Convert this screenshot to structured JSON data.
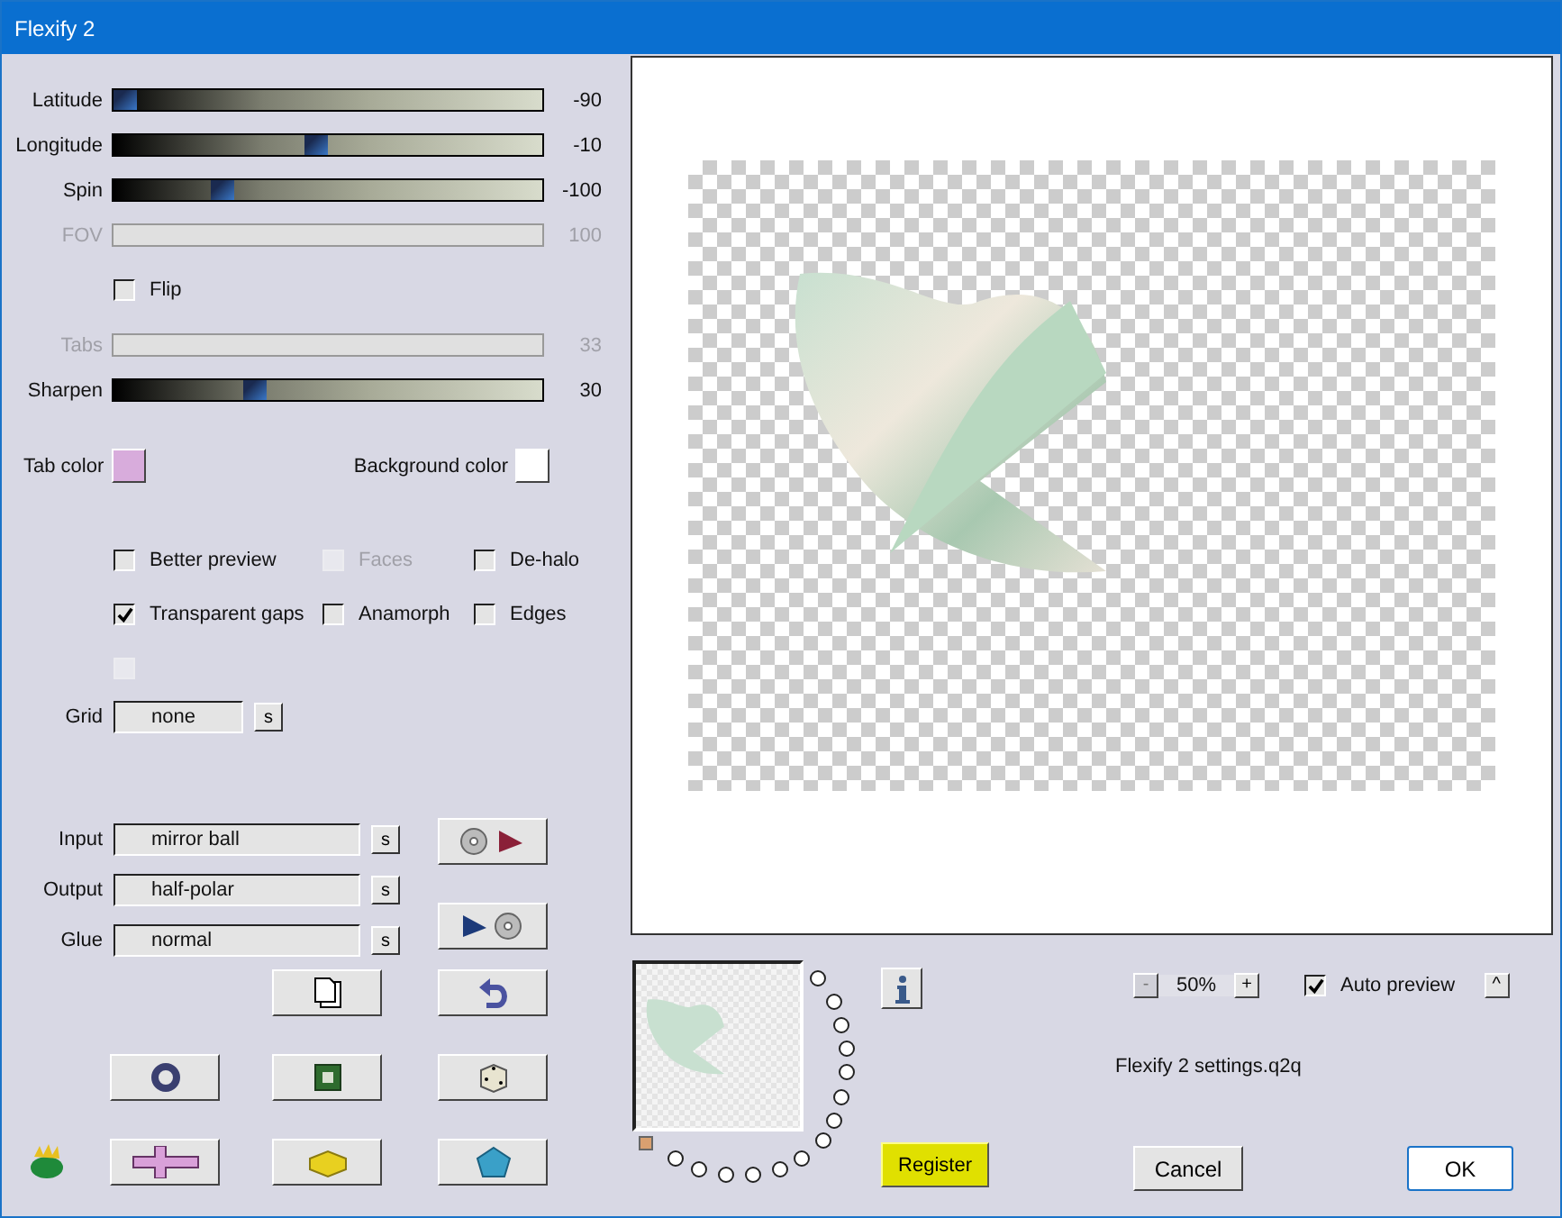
{
  "window": {
    "title": "Flexify 2"
  },
  "sliders": [
    {
      "label": "Latitude",
      "value": "-90",
      "level": 0,
      "disabled": false
    },
    {
      "label": "Longitude",
      "value": "-10",
      "level": 0.47,
      "disabled": false
    },
    {
      "label": "Spin",
      "value": "-100",
      "level": 0.24,
      "disabled": false
    },
    {
      "label": "FOV",
      "value": "100",
      "disabled": true
    },
    {
      "kind": "checkbox",
      "label": "Flip",
      "checked": false
    },
    {
      "label": "Tabs",
      "value": "33",
      "disabled": true
    },
    {
      "label": "Sharpen",
      "value": "30",
      "level": 0.32,
      "disabled": false
    }
  ],
  "colors": [
    {
      "label": "Tab color",
      "color": "#d8acdc"
    },
    {
      "label": "Background color",
      "color": "#ffffff"
    }
  ],
  "options": [
    {
      "label": "Better preview",
      "checked": false,
      "disabled": false
    },
    {
      "label": "Faces",
      "checked": false,
      "disabled": true
    },
    {
      "label": "De-halo",
      "checked": false,
      "disabled": false
    },
    {
      "label": "Transparent gaps",
      "checked": true,
      "disabled": false
    },
    {
      "label": "Anamorph",
      "checked": false,
      "disabled": false
    },
    {
      "label": "Edges",
      "checked": false,
      "disabled": false
    },
    {
      "checked": false,
      "disabled": true
    }
  ],
  "grid": {
    "label": "Grid",
    "value": "none",
    "button": "s"
  },
  "mappings": [
    {
      "label": "Input",
      "value": "mirror ball",
      "button": "s"
    },
    {
      "label": "Output",
      "value": "half-polar",
      "button": "s"
    },
    {
      "label": "Glue",
      "value": "normal",
      "button": "s"
    }
  ],
  "zoom": {
    "minus": "-",
    "value": "50%",
    "plus": "+"
  },
  "auto_preview": {
    "label": "Auto preview",
    "checked": true
  },
  "collapse_button": "^",
  "settings_file": "Flexify 2 settings.q2q",
  "buttons": {
    "register": "Register",
    "cancel": "Cancel",
    "ok": "OK"
  }
}
